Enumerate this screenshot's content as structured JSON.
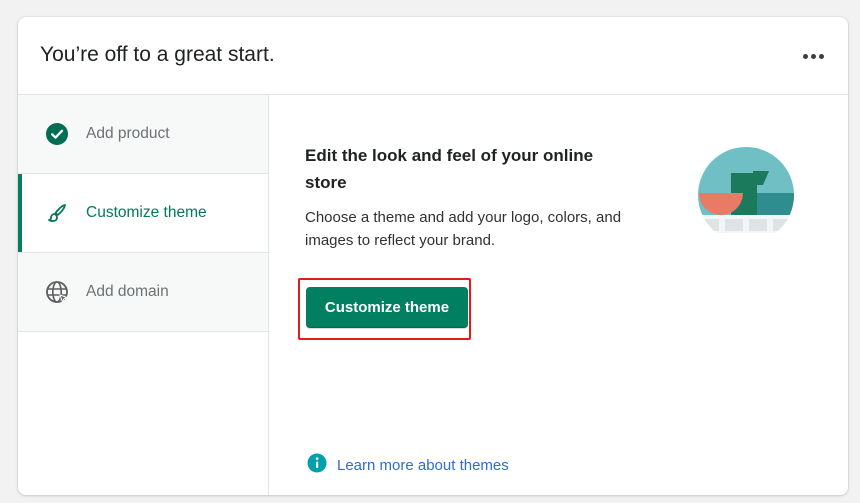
{
  "card": {
    "title": "You’re off to a great start.",
    "more_icon": "more-horizontal-icon"
  },
  "sidebar": {
    "items": [
      {
        "label": "Add product",
        "icon": "check-circle-icon",
        "state": "completed"
      },
      {
        "label": "Customize theme",
        "icon": "paintbrush-icon",
        "state": "active"
      },
      {
        "label": "Add domain",
        "icon": "globe-icon",
        "state": "default"
      }
    ]
  },
  "content": {
    "heading": "Edit the look and feel of your online store",
    "description": "Choose a theme and add your logo, colors, and images to reflect your brand.",
    "primary_button": "Customize theme",
    "learn_more": "Learn more about themes",
    "info_icon": "info-icon",
    "illustration": "theme-illustration"
  },
  "colors": {
    "accent": "#008060",
    "active_text": "#007a5a",
    "link": "#2c6ecb",
    "highlight": "#e21b1b",
    "info": "#00a0ac"
  }
}
